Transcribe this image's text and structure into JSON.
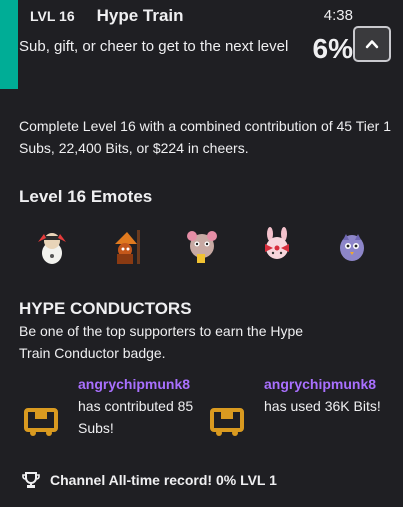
{
  "header": {
    "level_label": "LVL 16",
    "title": "Hype Train",
    "timer": "4:38",
    "subtitle": "Sub, gift, or cheer to get to the next level",
    "progress_percent": "6%",
    "collapse_button_icon": "chevron-up-icon"
  },
  "description": "Complete Level 16 with a combined contribution of 45 Tier 1 Subs, 22,400 Bits, or $224 in cheers.",
  "emotes": {
    "title": "Level 16 Emotes",
    "items": [
      "emote-1",
      "emote-2",
      "emote-3",
      "emote-4",
      "emote-5"
    ]
  },
  "conductors": {
    "title": "HYPE CONDUCTORS",
    "description": "Be one of the top supporters to earn the Hype Train Conductor badge.",
    "items": [
      {
        "username": "angrychipmunk8",
        "contribution": "has contributed 85 Subs!"
      },
      {
        "username": "angrychipmunk8",
        "contribution": "has used 36K Bits!"
      }
    ]
  },
  "record": "Channel All-time record! 0% LVL 1",
  "colors": {
    "accent": "#00ad96",
    "username": "#a970ff",
    "background": "#1f1f23",
    "badge": "#d99a20"
  }
}
